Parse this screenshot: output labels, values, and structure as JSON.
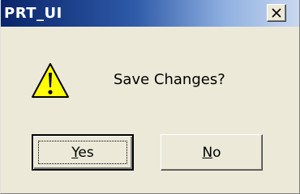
{
  "window": {
    "title": "PRT_UI",
    "close_icon": "close-icon",
    "colors": {
      "titlebar_start": "#0a246a",
      "titlebar_end": "#c9d8ef",
      "dialog_bg": "#ece9d8"
    }
  },
  "dialog": {
    "icon": "warning-icon",
    "message": "Save Changes?"
  },
  "buttons": {
    "yes_label": "Yes",
    "no_label": "No"
  }
}
